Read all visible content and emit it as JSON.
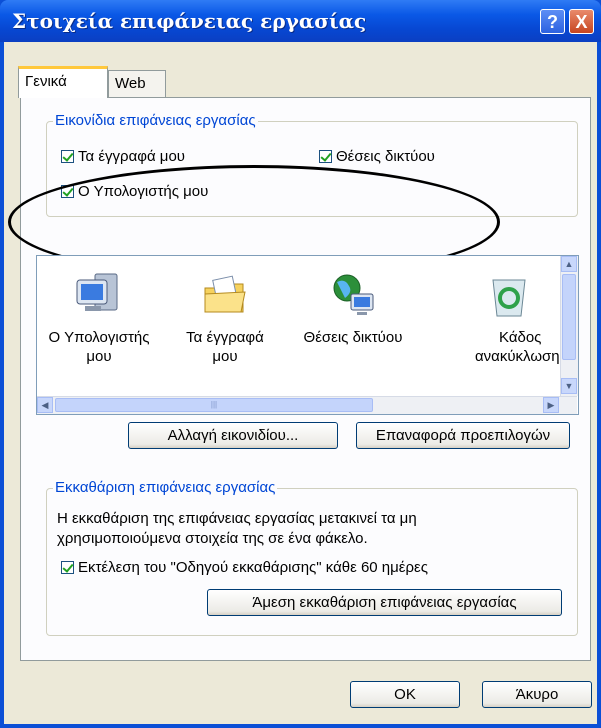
{
  "window": {
    "title": "Στοιχεία επιφάνειας εργασίας",
    "help_glyph": "?",
    "close_glyph": "X"
  },
  "tabs": [
    {
      "label": "Γενικά",
      "selected": true
    },
    {
      "label": "Web",
      "selected": false
    }
  ],
  "desktop_icons_group": {
    "label": "Εικονίδια επιφάνειας εργασίας",
    "checkboxes": [
      {
        "label": "Τα έγγραφά μου",
        "checked": true
      },
      {
        "label": "Θέσεις δικτύου",
        "checked": true
      },
      {
        "label": "Ο Υπολογιστής μου",
        "checked": true
      }
    ]
  },
  "icon_list": {
    "items": [
      {
        "icon": "my-computer-icon",
        "line1": "Ο Υπολογιστής",
        "line2": "μου"
      },
      {
        "icon": "my-documents-icon",
        "line1": "Τα έγγραφά",
        "line2": "μου"
      },
      {
        "icon": "network-places-icon",
        "line1": "Θέσεις δικτύου",
        "line2": ""
      },
      {
        "icon": "recycle-bin-icon",
        "line1": "Κάδος",
        "line2": "ανακύκλωσης"
      }
    ],
    "scroll_grip": "|||"
  },
  "buttons": {
    "change_icon": "Αλλαγή εικονιδίου...",
    "restore_default": "Επαναφορά προεπιλογών",
    "cleanup_now": "Άμεση εκκαθάριση επιφάνειας εργασίας",
    "ok": "OK",
    "cancel": "Άκυρο"
  },
  "cleanup_group": {
    "label": "Εκκαθάριση επιφάνειας εργασίας",
    "description_line1": "Η εκκαθάριση της επιφάνειας εργασίας μετακινεί τα μη",
    "description_line2": "χρησιμοποιούμενα στοιχεία της σε ένα φάκελο.",
    "wizard_checkbox": {
      "label": "Εκτέλεση του \"Οδηγού εκκαθάρισης\" κάθε 60 ημέρες",
      "checked": true
    }
  },
  "colors": {
    "title_bar": "#0a58e6",
    "dialog_face": "#ece9d8",
    "group_label": "#0046d5"
  }
}
